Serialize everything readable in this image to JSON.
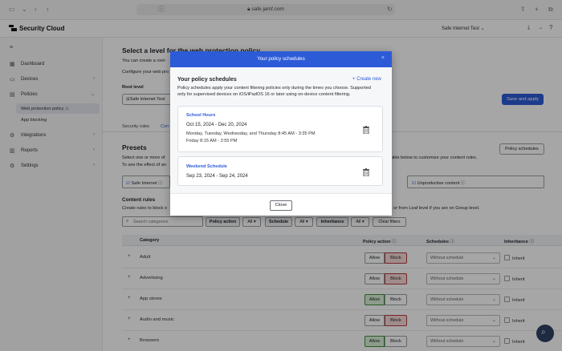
{
  "browser": {
    "url": "safe.jamf.com"
  },
  "app": {
    "brand": "Security Cloud",
    "tenant": "Safe Internet Test"
  },
  "sidebar": {
    "items": [
      {
        "label": "Dashboard"
      },
      {
        "label": "Devices"
      },
      {
        "label": "Policies"
      },
      {
        "label": "Integrations"
      },
      {
        "label": "Reports"
      },
      {
        "label": "Settings"
      }
    ],
    "policy_subitems": [
      {
        "label": "Web protection policy"
      },
      {
        "label": "App blocking"
      }
    ]
  },
  "main": {
    "heading": "Select a level for the web protection policy",
    "desc1": "You can create a root-",
    "desc2": "Configure your web pro",
    "root_level_label": "Root level",
    "root_level_value": "Safe Internet Test",
    "save_apply": "Save and apply",
    "tabs": [
      {
        "label": "Security rules"
      },
      {
        "label": "Con"
      }
    ],
    "presets_title": "Presets",
    "presets_desc1": "Select one or more of",
    "presets_desc1b": "able below to customize your content rules.",
    "presets_desc2": "To see the effect of an",
    "policy_schedules_btn": "Policy schedules",
    "preset_safe_internet": "Safe Internet",
    "preset_unproductive": "Unproductive content",
    "content_rules_title": "Content rules",
    "content_rules_desc1": "Create rules to block o",
    "content_rules_desc2": ", or from Leaf level if you are on Group level.",
    "search_placeholder": "Search categories",
    "filters": {
      "policy_action": "Policy action",
      "all1": "All",
      "schedule": "Schedule",
      "all2": "All",
      "inheritance": "Inheritance",
      "all3": "All",
      "clear": "Clear filters"
    },
    "table": {
      "col_category": "Category",
      "col_policy_action": "Policy action",
      "col_schedules": "Schedules",
      "col_inheritance": "Inheritance",
      "rows": [
        {
          "category": "Adult",
          "allow": "Allow",
          "block": "Block",
          "schedule": "Without schedule",
          "inherit": "Inherit",
          "active": "block"
        },
        {
          "category": "Advertising",
          "allow": "Allow",
          "block": "Block",
          "schedule": "Without schedule",
          "inherit": "Inherit",
          "active": "block"
        },
        {
          "category": "App stores",
          "allow": "Allow",
          "block": "Block",
          "schedule": "Without schedule",
          "inherit": "Inherit",
          "active": "allow"
        },
        {
          "category": "Audio and music",
          "allow": "Allow",
          "block": "Block",
          "schedule": "Without schedule",
          "inherit": "Inherit",
          "active": "block"
        },
        {
          "category": "Browsers",
          "allow": "Allow",
          "block": "Block",
          "schedule": "Without schedule",
          "inherit": "Inherit",
          "active": "allow"
        }
      ]
    }
  },
  "modal": {
    "header_title": "Your policy schedules",
    "body_title": "Your policy schedules",
    "create_new": "Create new",
    "desc_line1": "Policy schedules apply your content filtering policies only during the times you choose. Supported",
    "desc_line2": "only for supervised devices on iOS/iPadOS 16 or later using on-device content filtering.",
    "schedules": [
      {
        "name": "School Hours",
        "dates": "Oct 15, 2024 - Dec 20, 2024",
        "times1": "Monday, Tuesday, Wednesday, and Thursday 8:45 AM - 3:35 PM",
        "times2": "Friday 8:15 AM - 2:55 PM"
      },
      {
        "name": "Weekend Schedule",
        "dates": "Sep 23, 2024 - Sep 24, 2024"
      }
    ],
    "close_label": "Close"
  },
  "colors": {
    "primary": "#2d5bd7",
    "block_active": "#f8d7d7",
    "allow_active": "#d8f0d4"
  }
}
